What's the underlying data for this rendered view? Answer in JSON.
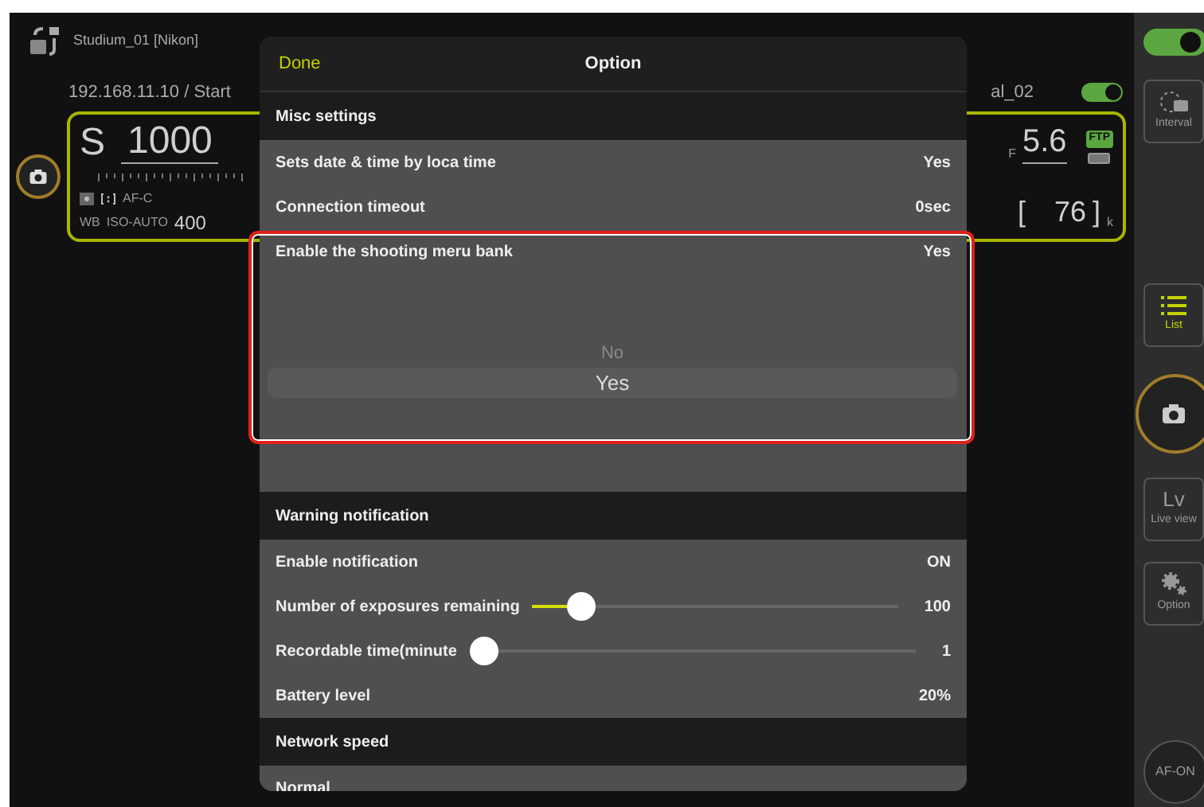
{
  "camera": {
    "name": "Studium_01 [Nikon]",
    "connection": "192.168.11.10 / Start",
    "name_2": "al_02",
    "enabled": true
  },
  "panel": {
    "mode": "S",
    "shutter_speed": "1000",
    "focus_mode": "AF-C",
    "wb": "WB",
    "iso_label": "ISO-AUTO",
    "iso": "400",
    "aperture_prefix": "F",
    "aperture": "5.6",
    "transfer_badge": "FTP",
    "frames_open": "[",
    "frames": "76",
    "frames_close": "]",
    "frames_unit": "k"
  },
  "sidebar": {
    "toggle_on": true,
    "buttons": [
      {
        "kind": "interval",
        "label": "Interval",
        "selected": false
      },
      {
        "kind": "list",
        "label": "List",
        "selected": true
      },
      {
        "kind": "shutter"
      },
      {
        "kind": "liveview",
        "glyph": "Lv",
        "label": "Live view",
        "selected": false
      },
      {
        "kind": "option",
        "label": "Option",
        "selected": false
      },
      {
        "kind": "circle",
        "label": "AF-ON"
      }
    ]
  },
  "dialog": {
    "done": "Done",
    "title": "Option",
    "sections": [
      {
        "title": "Misc settings",
        "rows": [
          {
            "kind": "value",
            "label": "Sets date & time by loca time",
            "value": "Yes"
          },
          {
            "kind": "value",
            "label": "Connection timeout",
            "value": "0sec"
          },
          {
            "kind": "picker",
            "label": "Enable the shooting meru bank",
            "value": "Yes",
            "highlighted": true,
            "options": [
              {
                "label": "No",
                "selected": false
              },
              {
                "label": "Yes",
                "selected": true
              }
            ]
          }
        ]
      },
      {
        "title": "Warning notification",
        "rows": [
          {
            "kind": "value",
            "label": "Enable notification",
            "value": "ON"
          },
          {
            "kind": "slider",
            "label": "Number of exposures remaining",
            "level": 0.1,
            "value": "100"
          },
          {
            "kind": "slider",
            "label": "Recordable time(minute",
            "level": 0,
            "value": "1"
          },
          {
            "kind": "value",
            "label": "Battery level",
            "value": "20%"
          }
        ]
      },
      {
        "title": "Network speed",
        "rows": [
          {
            "kind": "link",
            "label": "Normal"
          }
        ]
      }
    ]
  }
}
